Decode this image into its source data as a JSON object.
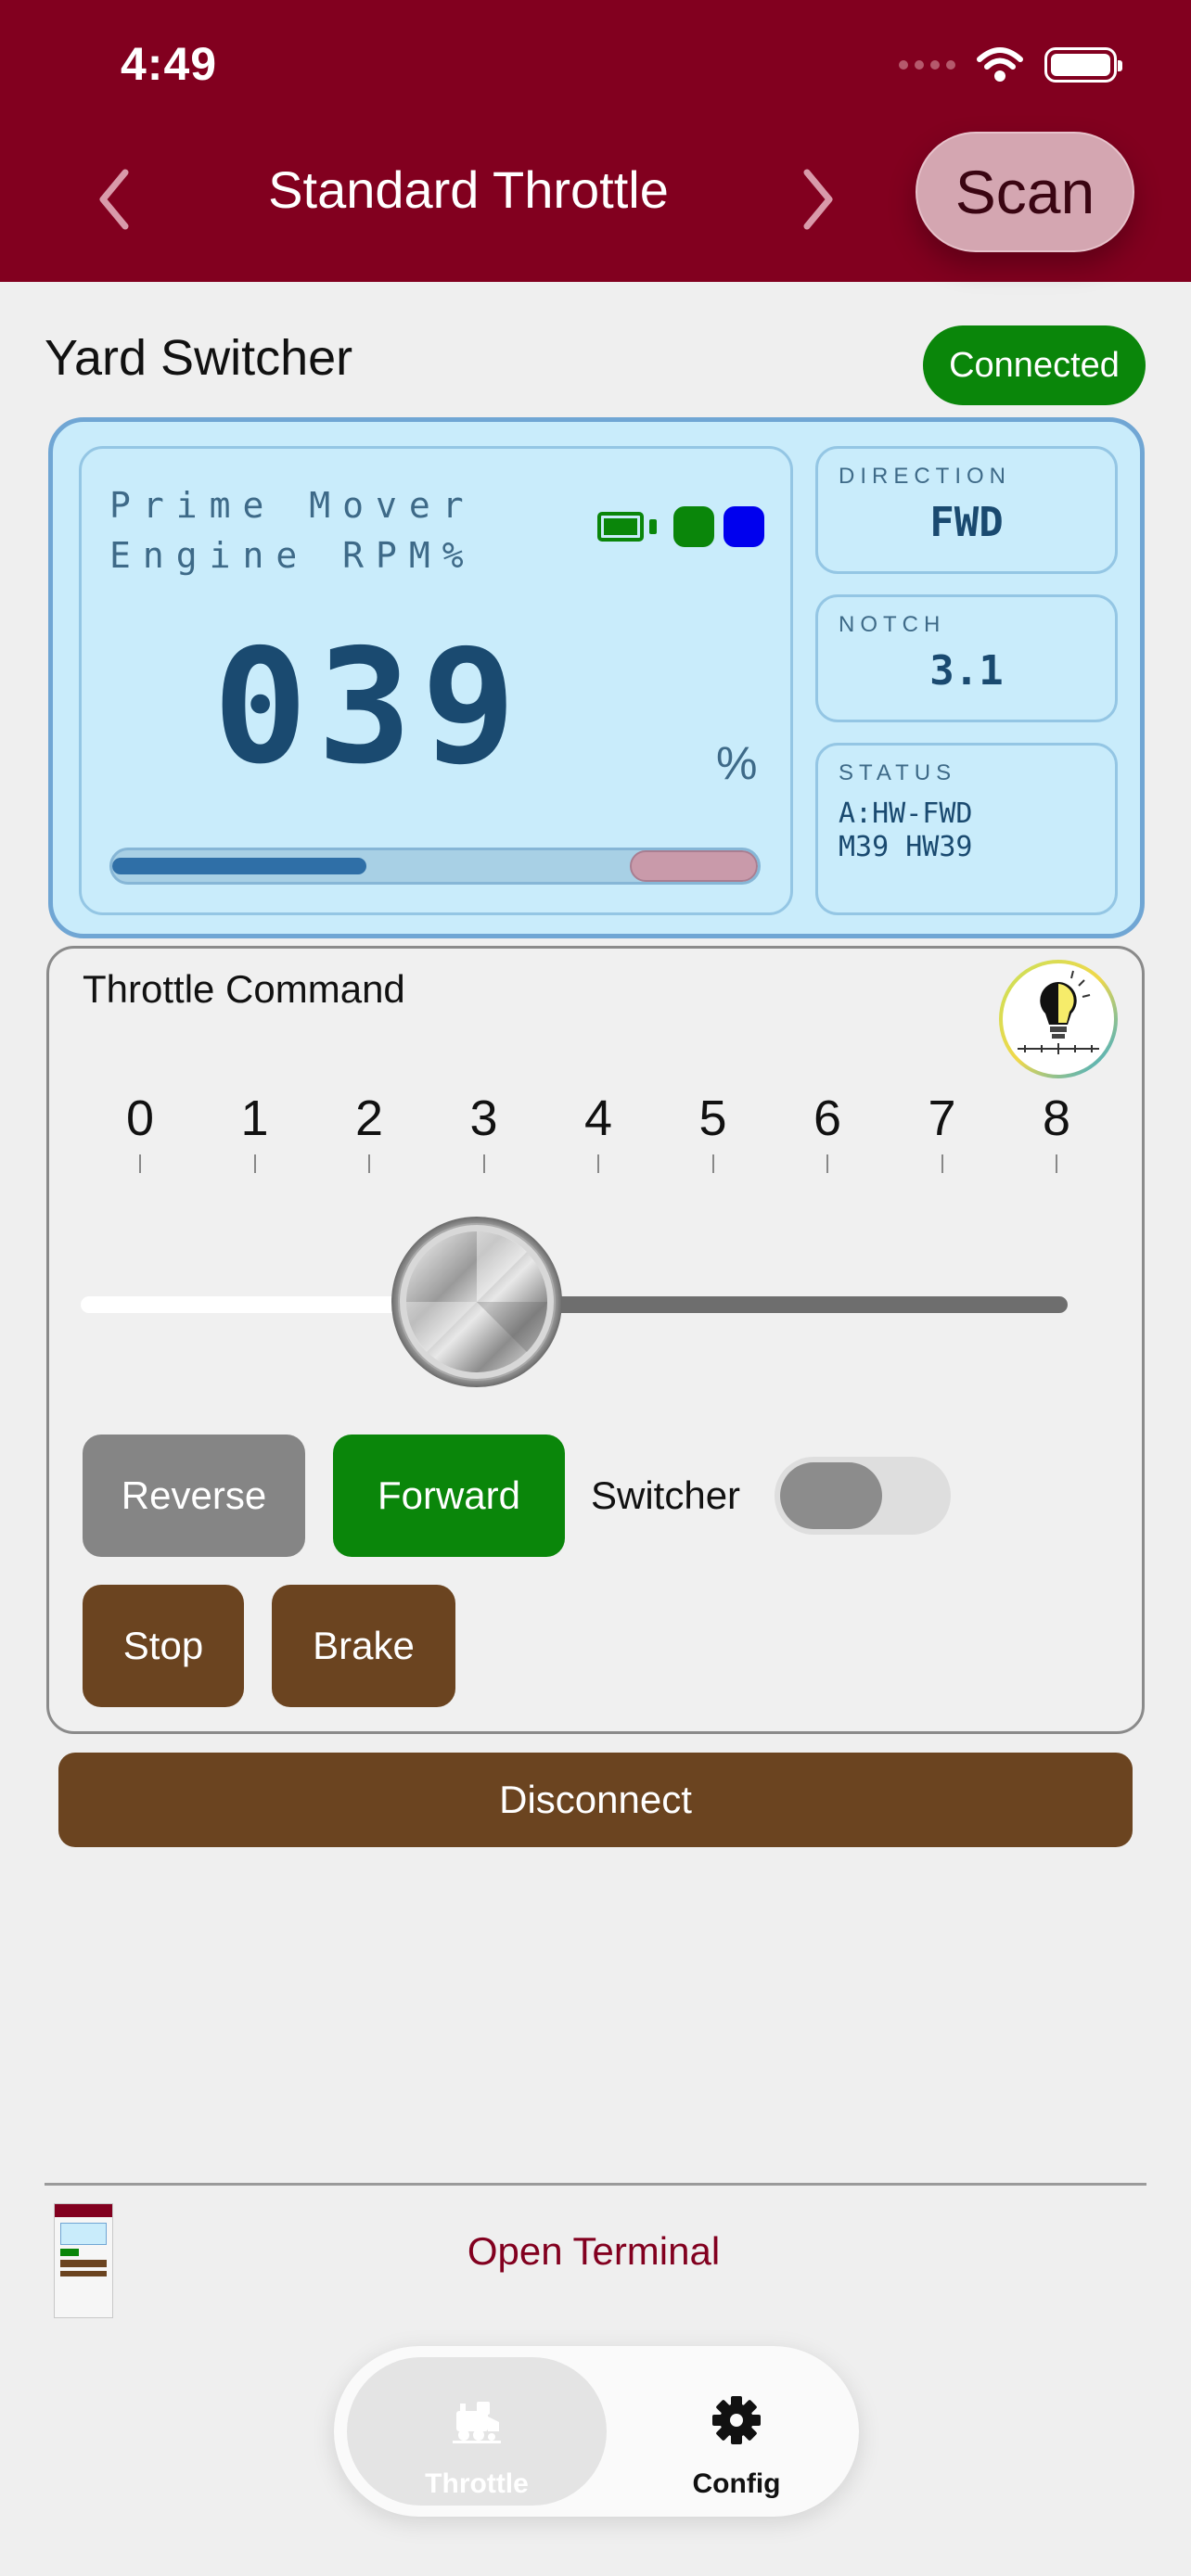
{
  "status_bar": {
    "time": "4:49"
  },
  "nav": {
    "title": "Standard Throttle",
    "scan_label": "Scan"
  },
  "loco": {
    "name": "Yard Switcher",
    "connection_status": "Connected"
  },
  "display": {
    "rpm_label_line1": "Prime Mover",
    "rpm_label_line2": "Engine RPM%",
    "rpm_value": "039",
    "rpm_unit": "%",
    "rpm_fraction": 0.39,
    "indicator_colors": [
      "#0a860a",
      "#0a860a",
      "#0000ee"
    ],
    "direction_label": "DIRECTION",
    "direction_value": "FWD",
    "notch_label": "NOTCH",
    "notch_value": "3.1",
    "status_label": "STATUS",
    "status_line1": "A:HW-FWD",
    "status_line2": "M39 HW39"
  },
  "throttle": {
    "title": "Throttle Command",
    "notch_labels": [
      "0",
      "1",
      "2",
      "3",
      "4",
      "5",
      "6",
      "7",
      "8"
    ],
    "slider_value": 3.1,
    "reverse_label": "Reverse",
    "forward_label": "Forward",
    "switcher_label": "Switcher",
    "switcher_on": false,
    "stop_label": "Stop",
    "brake_label": "Brake"
  },
  "disconnect_label": "Disconnect",
  "terminal_label": "Open Terminal",
  "tabs": [
    {
      "label": "Throttle",
      "icon": "train-icon",
      "selected": true
    },
    {
      "label": "Config",
      "icon": "gear-icon",
      "selected": false
    }
  ],
  "colors": {
    "brand": "#82001f",
    "connected": "#0a860a",
    "forward": "#0a860a",
    "reverse": "#858585",
    "brake": "#6b4420",
    "display_bg": "#c9ecfb"
  }
}
